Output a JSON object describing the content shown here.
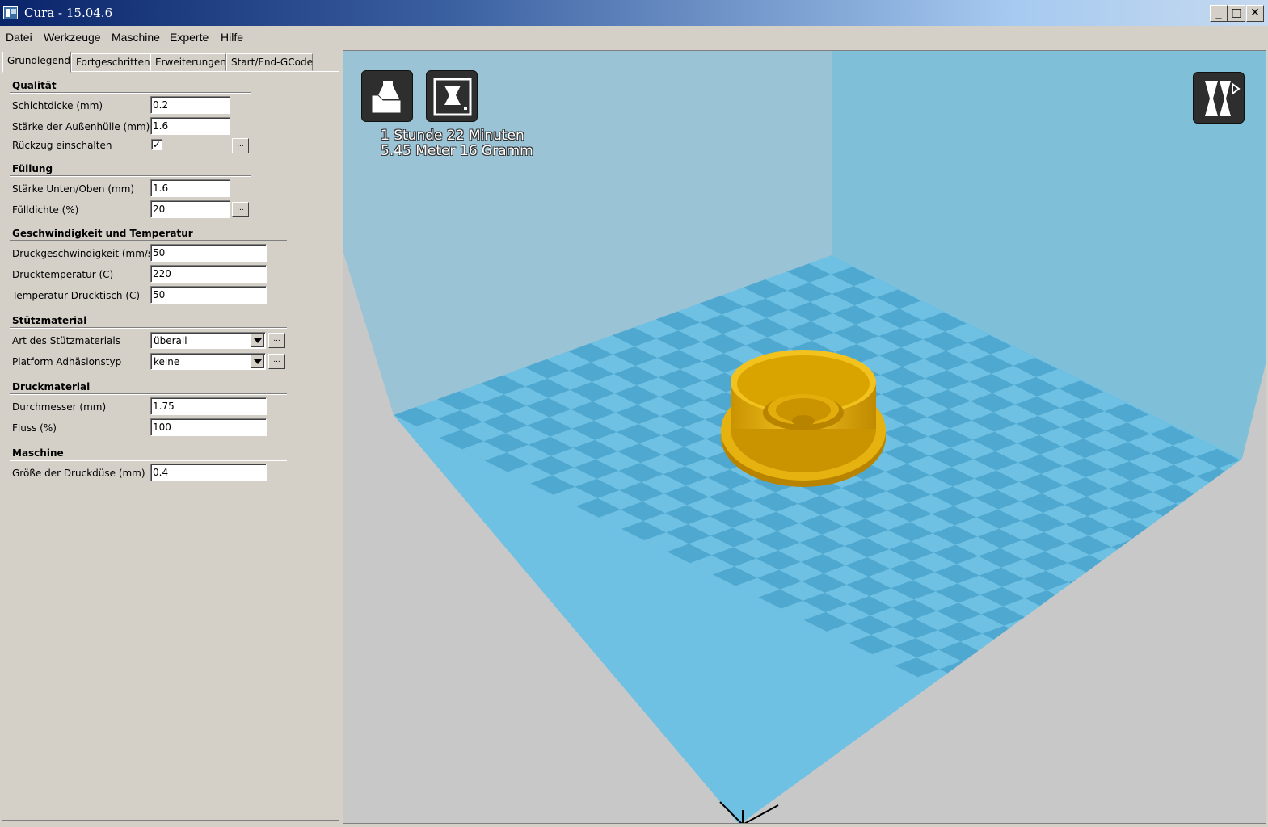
{
  "window": {
    "title": "Cura - 15.04.6"
  },
  "menu": [
    "Datei",
    "Werkzeuge",
    "Maschine",
    "Experte",
    "Hilfe"
  ],
  "tabs": [
    "Grundlegend",
    "Fortgeschritten",
    "Erweiterungen",
    "Start/End-GCode"
  ],
  "active_tab": "Grundlegend",
  "sections": {
    "quality": {
      "title": "Qualität",
      "layer_height_label": "Schichtdicke (mm)",
      "layer_height": "0.2",
      "shell_label": "Stärke der Außenhülle (mm)",
      "shell": "1.6",
      "retraction_label": "Rückzug einschalten",
      "retraction_checked": true
    },
    "fill": {
      "title": "Füllung",
      "bottom_top_label": "Stärke Unten/Oben (mm)",
      "bottom_top": "1.6",
      "density_label": "Fülldichte (%)",
      "density": "20"
    },
    "speed": {
      "title": "Geschwindigkeit und Temperatur",
      "print_speed_label": "Druckgeschwindigkeit (mm/s)",
      "print_speed": "50",
      "print_temp_label": "Drucktemperatur (C)",
      "print_temp": "220",
      "bed_temp_label": "Temperatur Drucktisch (C)",
      "bed_temp": "50"
    },
    "support": {
      "title": "Stützmaterial",
      "type_label": "Art des Stützmaterials",
      "type": "überall",
      "adhesion_label": "Platform Adhäsionstyp",
      "adhesion": "keine"
    },
    "filament": {
      "title": "Druckmaterial",
      "diameter_label": "Durchmesser (mm)",
      "diameter": "1.75",
      "flow_label": "Fluss (%)",
      "flow": "100"
    },
    "machine": {
      "title": "Maschine",
      "nozzle_label": "Größe der Druckdüse (mm)",
      "nozzle": "0.4"
    }
  },
  "viewport": {
    "print_time": "1 Stunde 22 Minuten",
    "print_material": "5.45 Meter 16 Gramm",
    "icons": [
      "load-model-icon",
      "save-toolpath-icon",
      "view-mode-icon"
    ],
    "colors": {
      "model": "#e8b40a",
      "floor_light": "#6fc1e3",
      "floor_dark": "#4fa8d0",
      "wall_left": "#9ac3d6",
      "wall_back": "#7fc0d8",
      "outside": "#c8c8c8"
    }
  }
}
